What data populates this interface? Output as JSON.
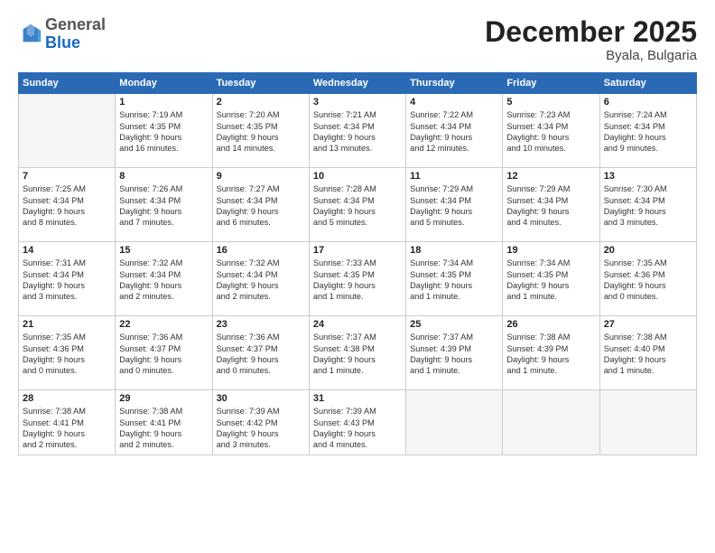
{
  "logo": {
    "general": "General",
    "blue": "Blue"
  },
  "title": "December 2025",
  "location": "Byala, Bulgaria",
  "days_of_week": [
    "Sunday",
    "Monday",
    "Tuesday",
    "Wednesday",
    "Thursday",
    "Friday",
    "Saturday"
  ],
  "weeks": [
    [
      {
        "day": "",
        "info": ""
      },
      {
        "day": "1",
        "info": "Sunrise: 7:19 AM\nSunset: 4:35 PM\nDaylight: 9 hours\nand 16 minutes."
      },
      {
        "day": "2",
        "info": "Sunrise: 7:20 AM\nSunset: 4:35 PM\nDaylight: 9 hours\nand 14 minutes."
      },
      {
        "day": "3",
        "info": "Sunrise: 7:21 AM\nSunset: 4:34 PM\nDaylight: 9 hours\nand 13 minutes."
      },
      {
        "day": "4",
        "info": "Sunrise: 7:22 AM\nSunset: 4:34 PM\nDaylight: 9 hours\nand 12 minutes."
      },
      {
        "day": "5",
        "info": "Sunrise: 7:23 AM\nSunset: 4:34 PM\nDaylight: 9 hours\nand 10 minutes."
      },
      {
        "day": "6",
        "info": "Sunrise: 7:24 AM\nSunset: 4:34 PM\nDaylight: 9 hours\nand 9 minutes."
      }
    ],
    [
      {
        "day": "7",
        "info": "Sunrise: 7:25 AM\nSunset: 4:34 PM\nDaylight: 9 hours\nand 8 minutes."
      },
      {
        "day": "8",
        "info": "Sunrise: 7:26 AM\nSunset: 4:34 PM\nDaylight: 9 hours\nand 7 minutes."
      },
      {
        "day": "9",
        "info": "Sunrise: 7:27 AM\nSunset: 4:34 PM\nDaylight: 9 hours\nand 6 minutes."
      },
      {
        "day": "10",
        "info": "Sunrise: 7:28 AM\nSunset: 4:34 PM\nDaylight: 9 hours\nand 5 minutes."
      },
      {
        "day": "11",
        "info": "Sunrise: 7:29 AM\nSunset: 4:34 PM\nDaylight: 9 hours\nand 5 minutes."
      },
      {
        "day": "12",
        "info": "Sunrise: 7:29 AM\nSunset: 4:34 PM\nDaylight: 9 hours\nand 4 minutes."
      },
      {
        "day": "13",
        "info": "Sunrise: 7:30 AM\nSunset: 4:34 PM\nDaylight: 9 hours\nand 3 minutes."
      }
    ],
    [
      {
        "day": "14",
        "info": "Sunrise: 7:31 AM\nSunset: 4:34 PM\nDaylight: 9 hours\nand 3 minutes."
      },
      {
        "day": "15",
        "info": "Sunrise: 7:32 AM\nSunset: 4:34 PM\nDaylight: 9 hours\nand 2 minutes."
      },
      {
        "day": "16",
        "info": "Sunrise: 7:32 AM\nSunset: 4:34 PM\nDaylight: 9 hours\nand 2 minutes."
      },
      {
        "day": "17",
        "info": "Sunrise: 7:33 AM\nSunset: 4:35 PM\nDaylight: 9 hours\nand 1 minute."
      },
      {
        "day": "18",
        "info": "Sunrise: 7:34 AM\nSunset: 4:35 PM\nDaylight: 9 hours\nand 1 minute."
      },
      {
        "day": "19",
        "info": "Sunrise: 7:34 AM\nSunset: 4:35 PM\nDaylight: 9 hours\nand 1 minute."
      },
      {
        "day": "20",
        "info": "Sunrise: 7:35 AM\nSunset: 4:36 PM\nDaylight: 9 hours\nand 0 minutes."
      }
    ],
    [
      {
        "day": "21",
        "info": "Sunrise: 7:35 AM\nSunset: 4:36 PM\nDaylight: 9 hours\nand 0 minutes."
      },
      {
        "day": "22",
        "info": "Sunrise: 7:36 AM\nSunset: 4:37 PM\nDaylight: 9 hours\nand 0 minutes."
      },
      {
        "day": "23",
        "info": "Sunrise: 7:36 AM\nSunset: 4:37 PM\nDaylight: 9 hours\nand 0 minutes."
      },
      {
        "day": "24",
        "info": "Sunrise: 7:37 AM\nSunset: 4:38 PM\nDaylight: 9 hours\nand 1 minute."
      },
      {
        "day": "25",
        "info": "Sunrise: 7:37 AM\nSunset: 4:39 PM\nDaylight: 9 hours\nand 1 minute."
      },
      {
        "day": "26",
        "info": "Sunrise: 7:38 AM\nSunset: 4:39 PM\nDaylight: 9 hours\nand 1 minute."
      },
      {
        "day": "27",
        "info": "Sunrise: 7:38 AM\nSunset: 4:40 PM\nDaylight: 9 hours\nand 1 minute."
      }
    ],
    [
      {
        "day": "28",
        "info": "Sunrise: 7:38 AM\nSunset: 4:41 PM\nDaylight: 9 hours\nand 2 minutes."
      },
      {
        "day": "29",
        "info": "Sunrise: 7:38 AM\nSunset: 4:41 PM\nDaylight: 9 hours\nand 2 minutes."
      },
      {
        "day": "30",
        "info": "Sunrise: 7:39 AM\nSunset: 4:42 PM\nDaylight: 9 hours\nand 3 minutes."
      },
      {
        "day": "31",
        "info": "Sunrise: 7:39 AM\nSunset: 4:43 PM\nDaylight: 9 hours\nand 4 minutes."
      },
      {
        "day": "",
        "info": ""
      },
      {
        "day": "",
        "info": ""
      },
      {
        "day": "",
        "info": ""
      }
    ]
  ]
}
